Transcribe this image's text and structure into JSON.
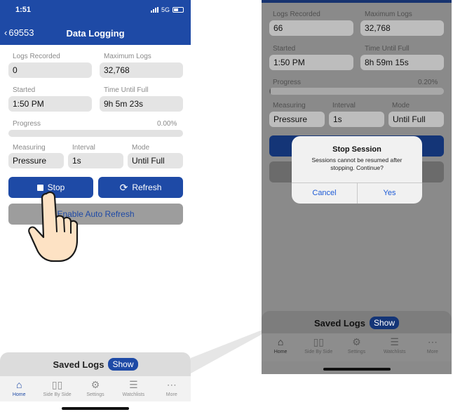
{
  "left": {
    "status": {
      "time": "1:51",
      "network": "5G"
    },
    "nav": {
      "back_label": "69553",
      "title": "Data Logging"
    },
    "fields": {
      "logs_recorded": {
        "label": "Logs Recorded",
        "value": "0"
      },
      "maximum_logs": {
        "label": "Maximum Logs",
        "value": "32,768"
      },
      "started": {
        "label": "Started",
        "value": "1:50 PM"
      },
      "time_until_full": {
        "label": "Time Until Full",
        "value": "9h 5m 23s"
      },
      "measuring": {
        "label": "Measuring",
        "value": "Pressure"
      },
      "interval": {
        "label": "Interval",
        "value": "1s"
      },
      "mode": {
        "label": "Mode",
        "value": "Until Full"
      }
    },
    "progress": {
      "label": "Progress",
      "value_text": "0.00%",
      "fraction": 0.0
    },
    "buttons": {
      "stop": "Stop",
      "refresh": "Refresh",
      "auto_refresh": "Enable Auto Refresh"
    },
    "saved_logs": {
      "title": "Saved Logs",
      "show": "Show"
    }
  },
  "right": {
    "fields": {
      "logs_recorded": {
        "label": "Logs Recorded",
        "value": "66"
      },
      "maximum_logs": {
        "label": "Maximum Logs",
        "value": "32,768"
      },
      "started": {
        "label": "Started",
        "value": "1:50 PM"
      },
      "time_until_full": {
        "label": "Time Until Full",
        "value": "8h 59m 15s"
      },
      "measuring": {
        "label": "Measuring",
        "value": "Pressure"
      },
      "interval": {
        "label": "Interval",
        "value": "1s"
      },
      "mode": {
        "label": "Mode",
        "value": "Until Full"
      }
    },
    "progress": {
      "label": "Progress",
      "value_text": "0.20%",
      "fraction": 0.002
    },
    "alert": {
      "title": "Stop Session",
      "message": "Sessions cannot be resumed after stopping. Continue?",
      "cancel": "Cancel",
      "confirm": "Yes"
    },
    "saved_logs": {
      "title": "Saved Logs",
      "show": "Show"
    }
  },
  "tabs": [
    {
      "label": "Home",
      "icon": "home-icon",
      "active": true
    },
    {
      "label": "Side By Side",
      "icon": "side-by-side-icon",
      "active": false
    },
    {
      "label": "Settings",
      "icon": "gear-icon",
      "active": false
    },
    {
      "label": "Watchlists",
      "icon": "list-icon",
      "active": false
    },
    {
      "label": "More",
      "icon": "more-icon",
      "active": false
    }
  ],
  "colors": {
    "brand_blue": "#1e4aa6",
    "alert_button_blue": "#1e5bd6"
  }
}
